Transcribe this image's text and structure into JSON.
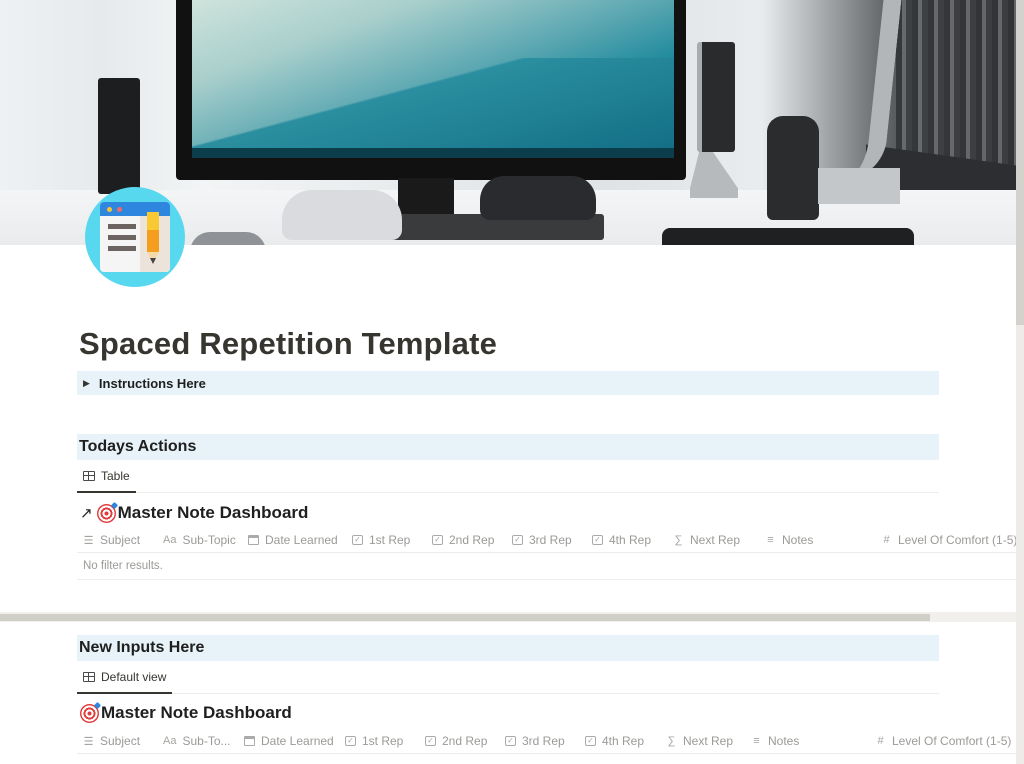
{
  "page": {
    "title": "Spaced Repetition Template",
    "icon": "notes-pencil-icon",
    "cover": "desk-setup-photo"
  },
  "toggle": {
    "label": "Instructions Here",
    "icon": "triangle-right-icon"
  },
  "sections": [
    {
      "heading": "Todays Actions",
      "view_tab": "Table",
      "database": {
        "linked": true,
        "link_icon": "↗",
        "title": "Master Note Dashboard",
        "emoji": "target-icon",
        "columns": [
          {
            "icon": "list-icon",
            "glyph": "☰",
            "label": "Subject"
          },
          {
            "icon": "text-icon",
            "glyph": "Aa",
            "label": "Sub-Topic"
          },
          {
            "icon": "calendar-icon",
            "glyph": "",
            "label": "Date Learned"
          },
          {
            "icon": "checkbox-icon",
            "glyph": "✓",
            "label": "1st Rep"
          },
          {
            "icon": "checkbox-icon",
            "glyph": "✓",
            "label": "2nd Rep"
          },
          {
            "icon": "checkbox-icon",
            "glyph": "✓",
            "label": "3rd Rep"
          },
          {
            "icon": "checkbox-icon",
            "glyph": "✓",
            "label": "4th Rep"
          },
          {
            "icon": "formula-icon",
            "glyph": "∑",
            "label": "Next Rep"
          },
          {
            "icon": "text-lines-icon",
            "glyph": "≡",
            "label": "Notes"
          },
          {
            "icon": "number-icon",
            "glyph": "#",
            "label": "Level Of Comfort (1-5)"
          }
        ],
        "empty_text": "No filter results."
      }
    },
    {
      "heading": "New Inputs Here",
      "view_tab": "Default view",
      "database": {
        "linked": false,
        "title": "Master Note Dashboard",
        "emoji": "target-icon",
        "columns": [
          {
            "icon": "list-icon",
            "glyph": "☰",
            "label": "Subject"
          },
          {
            "icon": "text-icon",
            "glyph": "Aa",
            "label": "Sub-To..."
          },
          {
            "icon": "calendar-icon",
            "glyph": "",
            "label": "Date Learned"
          },
          {
            "icon": "checkbox-icon",
            "glyph": "✓",
            "label": "1st Rep"
          },
          {
            "icon": "checkbox-icon",
            "glyph": "✓",
            "label": "2nd Rep"
          },
          {
            "icon": "checkbox-icon",
            "glyph": "✓",
            "label": "3rd Rep"
          },
          {
            "icon": "checkbox-icon",
            "glyph": "✓",
            "label": "4th Rep"
          },
          {
            "icon": "formula-icon",
            "glyph": "∑",
            "label": "Next Rep"
          },
          {
            "icon": "text-lines-icon",
            "glyph": "≡",
            "label": "Notes"
          },
          {
            "icon": "number-icon",
            "glyph": "#",
            "label": "Level Of Comfort (1-5)"
          }
        ]
      }
    }
  ],
  "colors": {
    "callout_bg": "#e7f3f8",
    "text": "#37352f",
    "muted": "#9b9a97",
    "accent": "#2e86de"
  }
}
